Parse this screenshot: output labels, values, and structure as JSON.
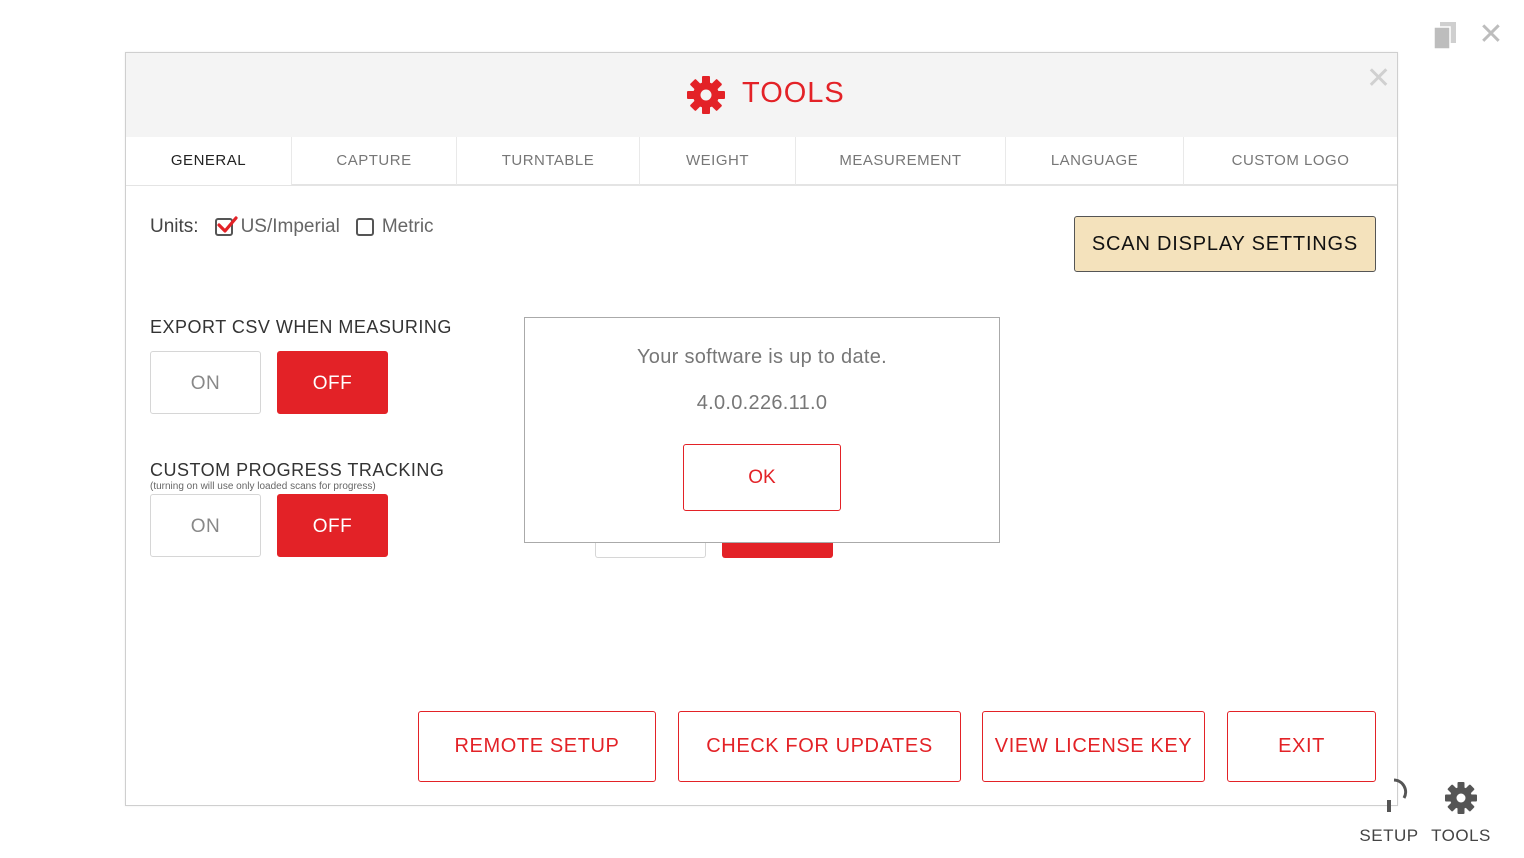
{
  "window": {
    "copy_icon": "copy-icon",
    "close_icon": "close-icon",
    "close_glyph": "✕"
  },
  "bottom_nav": {
    "setup_label": "SETUP",
    "tools_label": "TOOLS"
  },
  "dialog": {
    "title": "TOOLS",
    "title_icon": "gear-icon",
    "close_glyph": "✕",
    "accent_color": "#e32227",
    "tabs": [
      {
        "label": "GENERAL",
        "active": true
      },
      {
        "label": "CAPTURE",
        "active": false
      },
      {
        "label": "TURNTABLE",
        "active": false
      },
      {
        "label": "WEIGHT",
        "active": false
      },
      {
        "label": "MEASUREMENT",
        "active": false
      },
      {
        "label": "LANGUAGE",
        "active": false
      },
      {
        "label": "CUSTOM LOGO",
        "active": false
      }
    ],
    "units": {
      "label": "Units:",
      "options": [
        {
          "label": "US/Imperial",
          "checked": true
        },
        {
          "label": "Metric",
          "checked": false
        }
      ]
    },
    "scan_display_button": "SCAN DISPLAY SETTINGS",
    "export_csv": {
      "title": "EXPORT CSV WHEN MEASURING",
      "on_label": "ON",
      "off_label": "OFF",
      "value": "OFF"
    },
    "progress_tracking": {
      "title": "CUSTOM PROGRESS TRACKING",
      "note": "(turning on will use only loaded scans for progress)",
      "on_label": "ON",
      "off_label": "OFF",
      "value": "OFF"
    },
    "popup": {
      "message": "Your software is up to date.",
      "version": "4.0.0.226.11.0",
      "ok_label": "OK"
    },
    "bottom_buttons": {
      "remote_setup": "REMOTE SETUP",
      "check_updates": "CHECK FOR UPDATES",
      "view_license": "VIEW LICENSE KEY",
      "exit": "EXIT"
    }
  }
}
